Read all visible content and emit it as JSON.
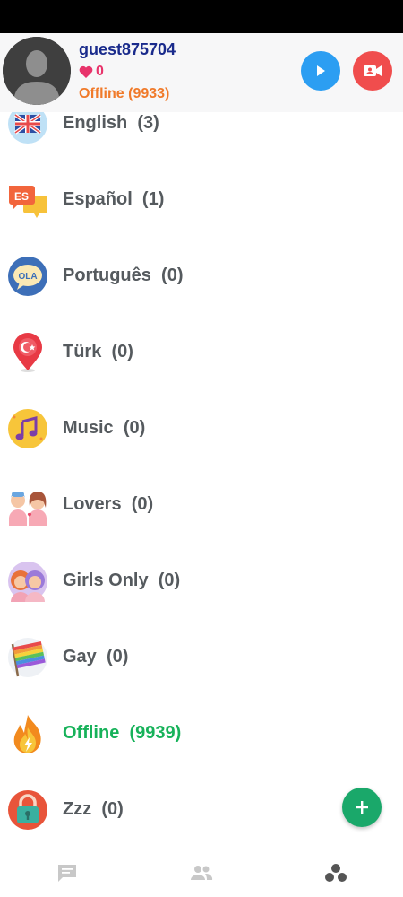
{
  "profile": {
    "username": "guest875704",
    "likes": "0",
    "status": "Offline (9933)"
  },
  "rooms": [
    {
      "name": "English",
      "count": "(3)"
    },
    {
      "name": "Español",
      "count": "(1)"
    },
    {
      "name": "Português",
      "count": "(0)"
    },
    {
      "name": "Türk",
      "count": "(0)"
    },
    {
      "name": "Music",
      "count": "(0)"
    },
    {
      "name": "Lovers",
      "count": "(0)"
    },
    {
      "name": "Girls Only",
      "count": "(0)"
    },
    {
      "name": "Gay",
      "count": "(0)"
    },
    {
      "name": "Offline",
      "count": "(9939)"
    },
    {
      "name": "Zzz",
      "count": "(0)"
    }
  ],
  "icon_labels": {
    "es": "ES",
    "ola": "OLA"
  },
  "colors": {
    "username": "#1a2b8c",
    "likes": "#e8336b",
    "status": "#f07a2a",
    "highlight_room": "#17b25a",
    "play_button": "#2c9ef2",
    "video_button": "#f04d4d",
    "fab": "#1aa86a"
  },
  "icons": {
    "header": [
      "avatar",
      "heart-icon",
      "play-icon",
      "video-call-icon"
    ],
    "rooms": [
      "uk-flag-icon",
      "es-chat-icon",
      "ola-bubble-icon",
      "turkey-pin-icon",
      "music-note-icon",
      "lovers-icon",
      "girls-icon",
      "rainbow-flag-icon",
      "fire-icon",
      "lock-icon"
    ],
    "fab": "plus-icon",
    "nav": [
      "chat-icon",
      "contacts-icon",
      "rooms-icon"
    ]
  }
}
